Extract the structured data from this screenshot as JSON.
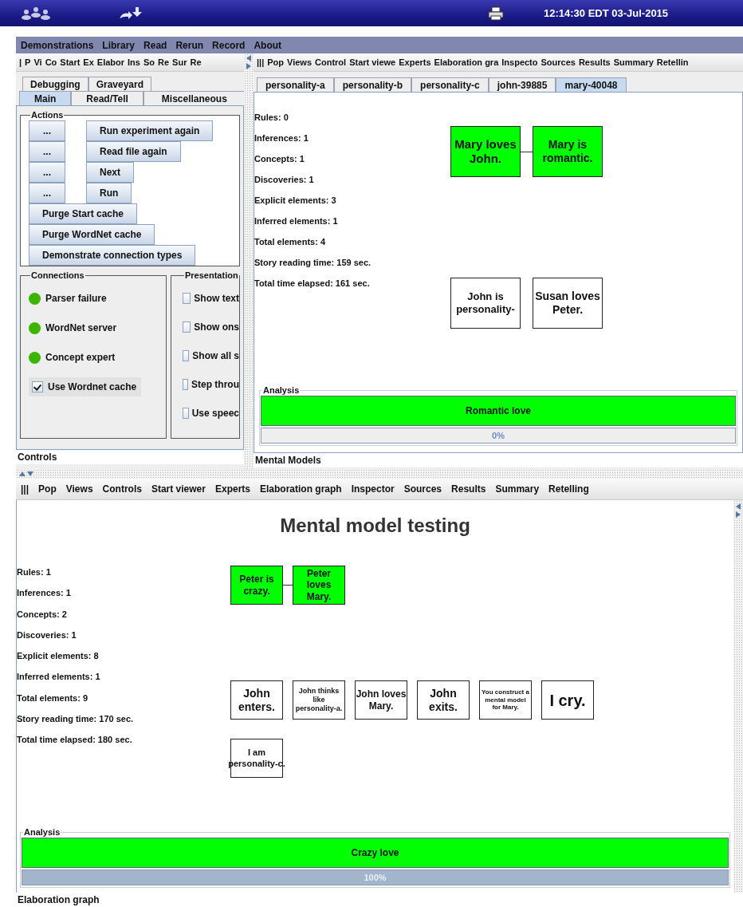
{
  "top_bar": {
    "clock": "12:14:30 EDT 03-Jul-2015"
  },
  "menu": [
    "Demonstrations",
    "Library",
    "Read",
    "Rerun",
    "Record",
    "About"
  ],
  "controls_panel": {
    "toolbar": [
      "|",
      "P",
      "Vi",
      "Co",
      "Start",
      "Ex",
      "Elabor",
      "Ins",
      "So",
      "Re",
      "Sur",
      "Re"
    ],
    "tab_rows": [
      [
        {
          "label": "Debugging",
          "selected": false
        },
        {
          "label": "Graveyard",
          "selected": false
        }
      ],
      [
        {
          "label": "Main",
          "selected": true
        },
        {
          "label": "Read/Tell",
          "selected": false
        },
        {
          "label": "Miscellaneous",
          "selected": false
        }
      ]
    ],
    "actions": {
      "title": "Actions",
      "rows": [
        [
          "...",
          "Run experiment again"
        ],
        [
          "...",
          "Read file again"
        ],
        [
          "...",
          "Next"
        ],
        [
          "...",
          "Run"
        ],
        [
          "Purge Start cache"
        ],
        [
          "Purge WordNet cache"
        ],
        [
          "Demonstrate connection types"
        ]
      ]
    },
    "connections": {
      "title": "Connections",
      "items": [
        {
          "kind": "status",
          "label": "Parser failure",
          "color": "#3cb400"
        },
        {
          "kind": "status",
          "label": "WordNet server",
          "color": "#3cb400"
        },
        {
          "kind": "status",
          "label": "Concept expert",
          "color": "#3cb400"
        },
        {
          "kind": "checkbox",
          "label": "Use Wordnet cache",
          "checked": true
        }
      ]
    },
    "presentation": {
      "title": "Presentation",
      "items": [
        {
          "label": "Show text",
          "checked": false
        },
        {
          "label": "Show ons",
          "checked": false
        },
        {
          "label": "Show all s",
          "checked": false
        },
        {
          "label": "Step throu",
          "checked": false
        },
        {
          "label": "Use speec",
          "checked": false
        }
      ]
    },
    "caption": "Controls"
  },
  "mental_models": {
    "toolbar": [
      "|||",
      "Pop",
      "Views",
      "Control",
      "Start viewe",
      "Experts",
      "Elaboration gra",
      "Inspecto",
      "Sources",
      "Results",
      "Summary",
      "Retellin"
    ],
    "tabs": [
      {
        "label": "personality-a",
        "selected": false
      },
      {
        "label": "personality-b",
        "selected": false
      },
      {
        "label": "personality-c",
        "selected": false
      },
      {
        "label": "john-39885",
        "selected": false
      },
      {
        "label": "mary-40048",
        "selected": true
      }
    ],
    "stats": [
      "Rules: 0",
      "Inferences: 1",
      "Concepts: 1",
      "Discoveries: 1",
      "Explicit elements: 3",
      "Inferred elements: 1",
      "Total elements: 4",
      "Story reading time: 159 sec.",
      "Total time elapsed: 161 sec."
    ],
    "graph": {
      "rows": [
        [
          {
            "text": "Mary loves John.",
            "highlighted": true,
            "linked": true
          },
          {
            "text": "Mary is romantic.",
            "highlighted": true,
            "linked": false
          }
        ],
        [
          {
            "text": "John is personality-",
            "highlighted": false,
            "linked": false
          },
          {
            "text": "Susan loves Peter.",
            "highlighted": false,
            "linked": false
          }
        ]
      ]
    },
    "analysis": {
      "title": "Analysis",
      "verdict": "Romantic love",
      "progress": {
        "text": "0%",
        "level": 0
      }
    },
    "caption": "Mental Models"
  },
  "elaboration": {
    "toolbar": [
      "|||",
      "Pop",
      "Views",
      "Controls",
      "Start viewer",
      "Experts",
      "Elaboration graph",
      "Inspector",
      "Sources",
      "Results",
      "Summary",
      "Retelling"
    ],
    "title": "Mental model testing",
    "stats": [
      "Rules: 1",
      "Inferences: 1",
      "Concepts: 2",
      "Discoveries: 1",
      "Explicit elements: 8",
      "Inferred elements: 1",
      "Total elements: 9",
      "Story reading time: 170 sec.",
      "Total time elapsed: 180 sec."
    ],
    "graph": {
      "rows": [
        [
          {
            "text": "Peter is crazy.",
            "highlighted": true,
            "linked": true
          },
          {
            "text": "Peter loves Mary.",
            "highlighted": true,
            "linked": false
          }
        ],
        [
          {
            "text": "John enters.",
            "highlighted": false,
            "linked": false
          },
          {
            "text": "John thinks like personality-a.",
            "highlighted": false,
            "linked": false
          },
          {
            "text": "John loves Mary.",
            "highlighted": false,
            "linked": false
          },
          {
            "text": "John exits.",
            "highlighted": false,
            "linked": false
          },
          {
            "text": "You construct a mental model for Mary.",
            "highlighted": false,
            "linked": false
          },
          {
            "text": "I cry.",
            "highlighted": false,
            "linked": false
          }
        ],
        [
          {
            "text": "I am personality-c.",
            "highlighted": false,
            "linked": false
          }
        ]
      ]
    },
    "analysis": {
      "title": "Analysis",
      "verdict": "Crazy love",
      "progress": {
        "text": "100%",
        "level": 1
      }
    },
    "caption": "Elaboration graph"
  }
}
